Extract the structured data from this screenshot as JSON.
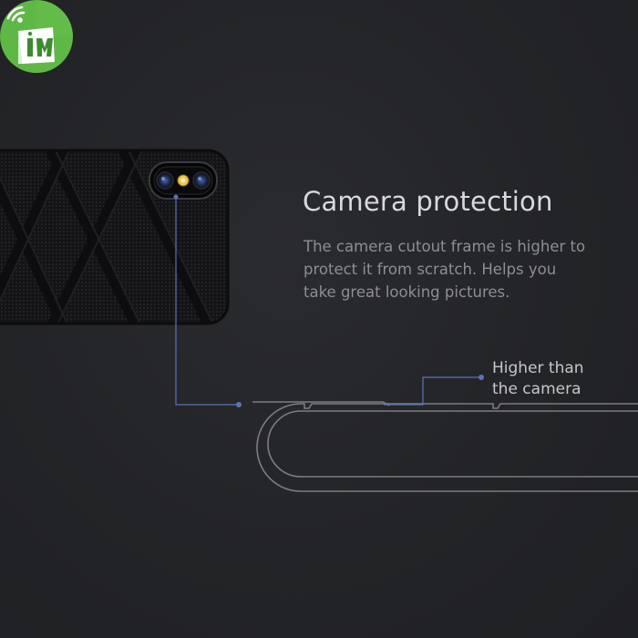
{
  "badge": {
    "icon": "wifi-shopping-bag-logo",
    "colors": {
      "green": "#5fb846",
      "dark_green": "#3b8d2c",
      "white": "#ffffff"
    }
  },
  "feature": {
    "title": "Camera protection",
    "description_lines": [
      "The camera cutout frame is higher to",
      "protect it from scratch. Helps you",
      "take great looking pictures."
    ]
  },
  "callout": {
    "lines": [
      "Higher than",
      "the camera"
    ],
    "line_color": "#5a73b8"
  },
  "colors": {
    "background": "#232427",
    "title": "#d8d9dc",
    "body_text": "#8c8e93",
    "case_outline": "#7b7d82"
  }
}
